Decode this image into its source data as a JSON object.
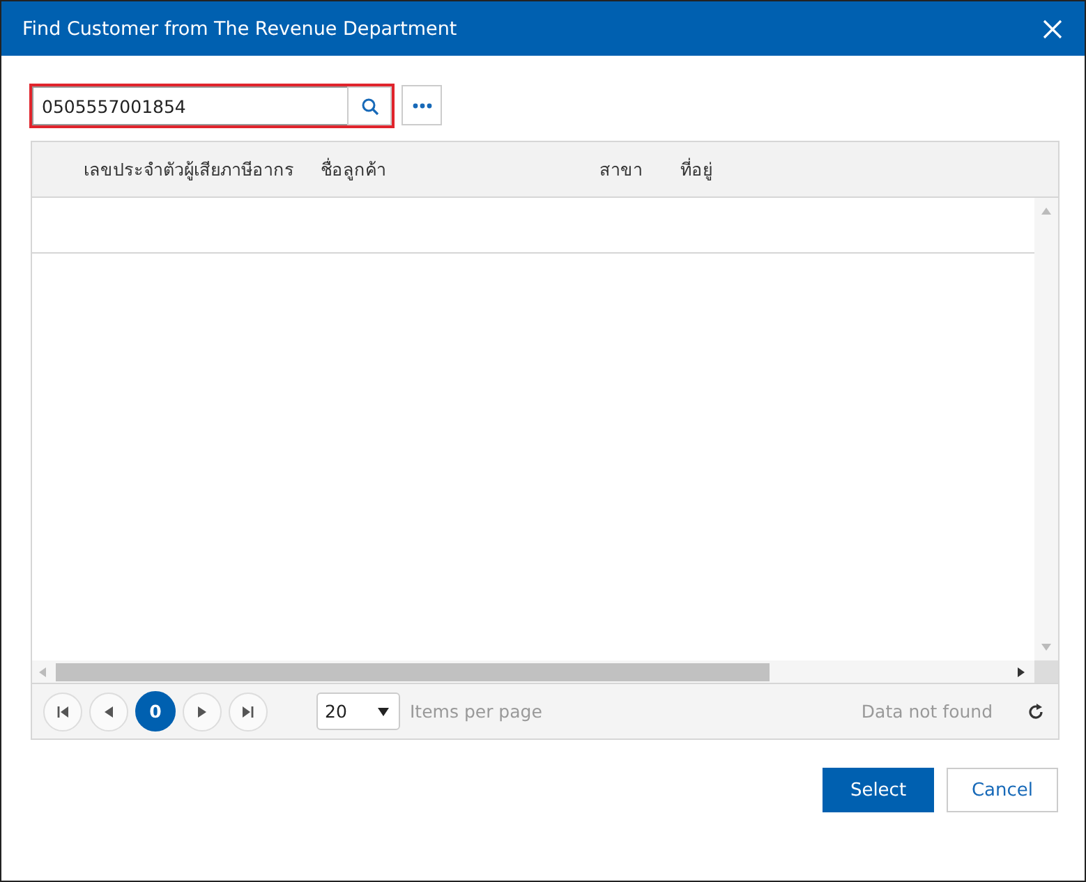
{
  "window": {
    "title": "Find Customer from The Revenue Department"
  },
  "search": {
    "value": "0505557001854"
  },
  "table": {
    "columns": [
      "เลขประจำตัวผู้เสียภาษีอากร",
      "ชื่อลูกค้า",
      "สาขา",
      "ที่อยู่"
    ]
  },
  "pager": {
    "page": "0",
    "page_size": "20",
    "page_size_label": "Items per page",
    "status": "Data not found"
  },
  "buttons": [
    {
      "label": "Select",
      "kind": "primary"
    },
    {
      "label": "Cancel",
      "kind": "secondary"
    }
  ]
}
